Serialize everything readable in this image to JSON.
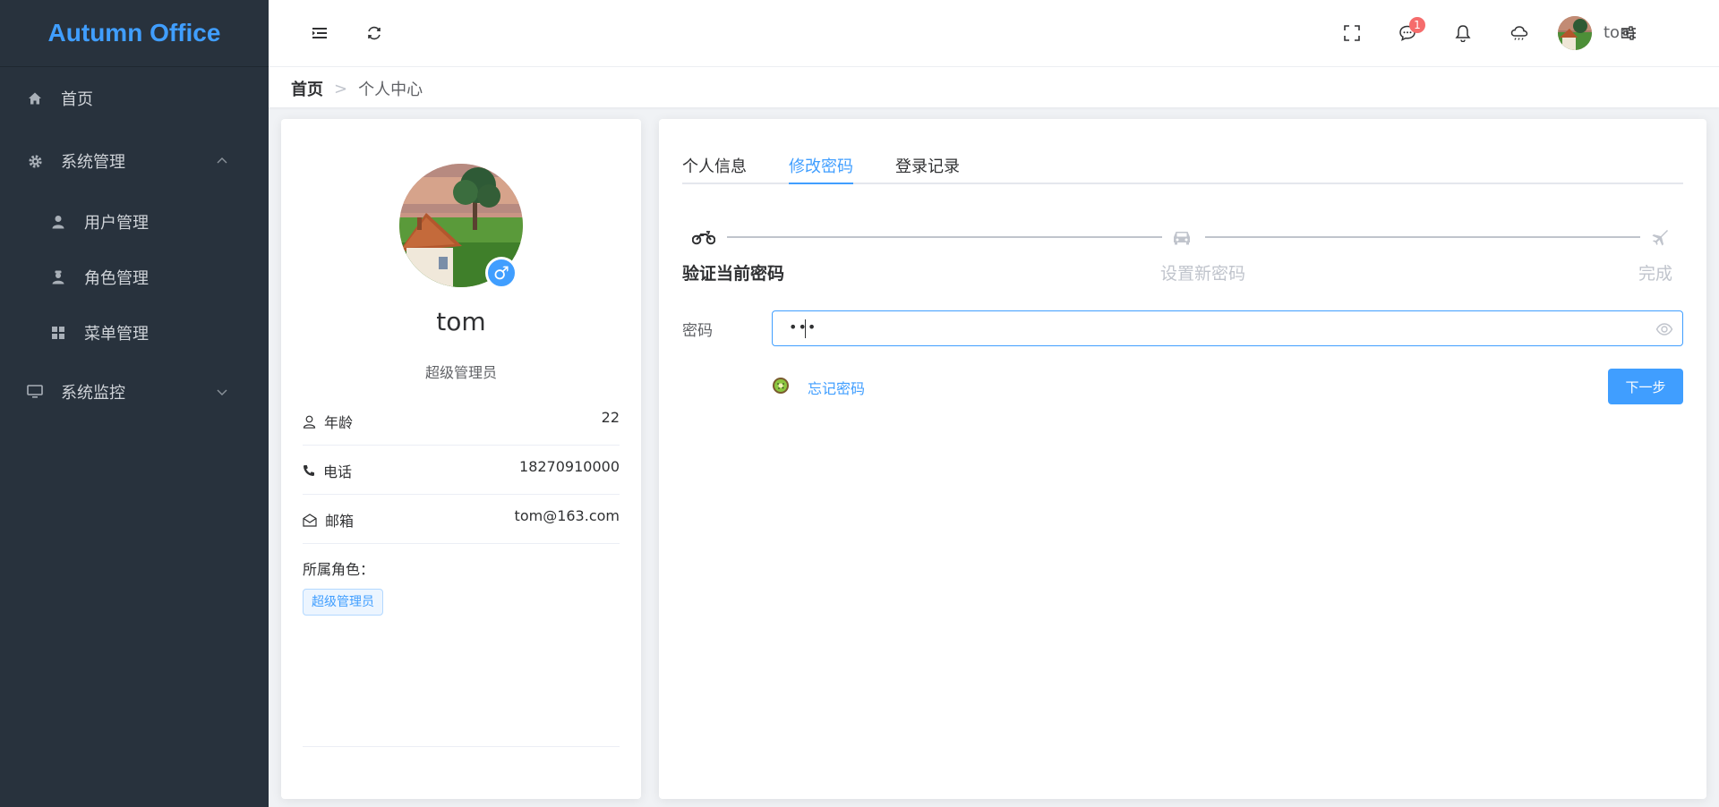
{
  "app": {
    "logo": "Autumn Office",
    "brand_color": "#409eff"
  },
  "sidebar": {
    "items": [
      {
        "label": "首页",
        "icon": "home-icon"
      },
      {
        "label": "系统管理",
        "icon": "gear-icon",
        "expanded": true,
        "children": [
          {
            "label": "用户管理",
            "icon": "user-icon"
          },
          {
            "label": "角色管理",
            "icon": "role-icon"
          },
          {
            "label": "菜单管理",
            "icon": "grid-icon"
          }
        ]
      },
      {
        "label": "系统监控",
        "icon": "monitor-icon",
        "expanded": false
      }
    ]
  },
  "header": {
    "icons": [
      "menu-fold-icon",
      "refresh-icon",
      "fullscreen-icon",
      "message-icon",
      "bell-icon",
      "cloud-icon",
      "settings-sliders-icon"
    ],
    "message_count": "1",
    "username": "tom"
  },
  "breadcrumb": {
    "home": "首页",
    "current": "个人中心",
    "separator": ">"
  },
  "profile": {
    "name": "tom",
    "gender_symbol": "♂",
    "role": "超级管理员",
    "fields": [
      {
        "label": "年龄",
        "value": "22",
        "icon": "person-icon"
      },
      {
        "label": "电话",
        "value": "18270910000",
        "icon": "phone-icon"
      },
      {
        "label": "邮箱",
        "value": "tom@163.com",
        "icon": "mail-icon"
      }
    ],
    "roles_title": "所属角色：",
    "roles": [
      "超级管理员"
    ]
  },
  "tabs": {
    "items": [
      "个人信息",
      "修改密码",
      "登录记录"
    ],
    "active": "修改密码"
  },
  "steps": {
    "items": [
      {
        "title": "验证当前密码",
        "icon": "motorcycle-icon",
        "status": "active"
      },
      {
        "title": "设置新密码",
        "icon": "car-icon",
        "status": "wait"
      },
      {
        "title": "完成",
        "icon": "plane-icon",
        "status": "wait"
      }
    ]
  },
  "form": {
    "password_label": "密码",
    "password_value": "•••",
    "forgot_label": "忘记密码",
    "next_label": "下一步"
  }
}
